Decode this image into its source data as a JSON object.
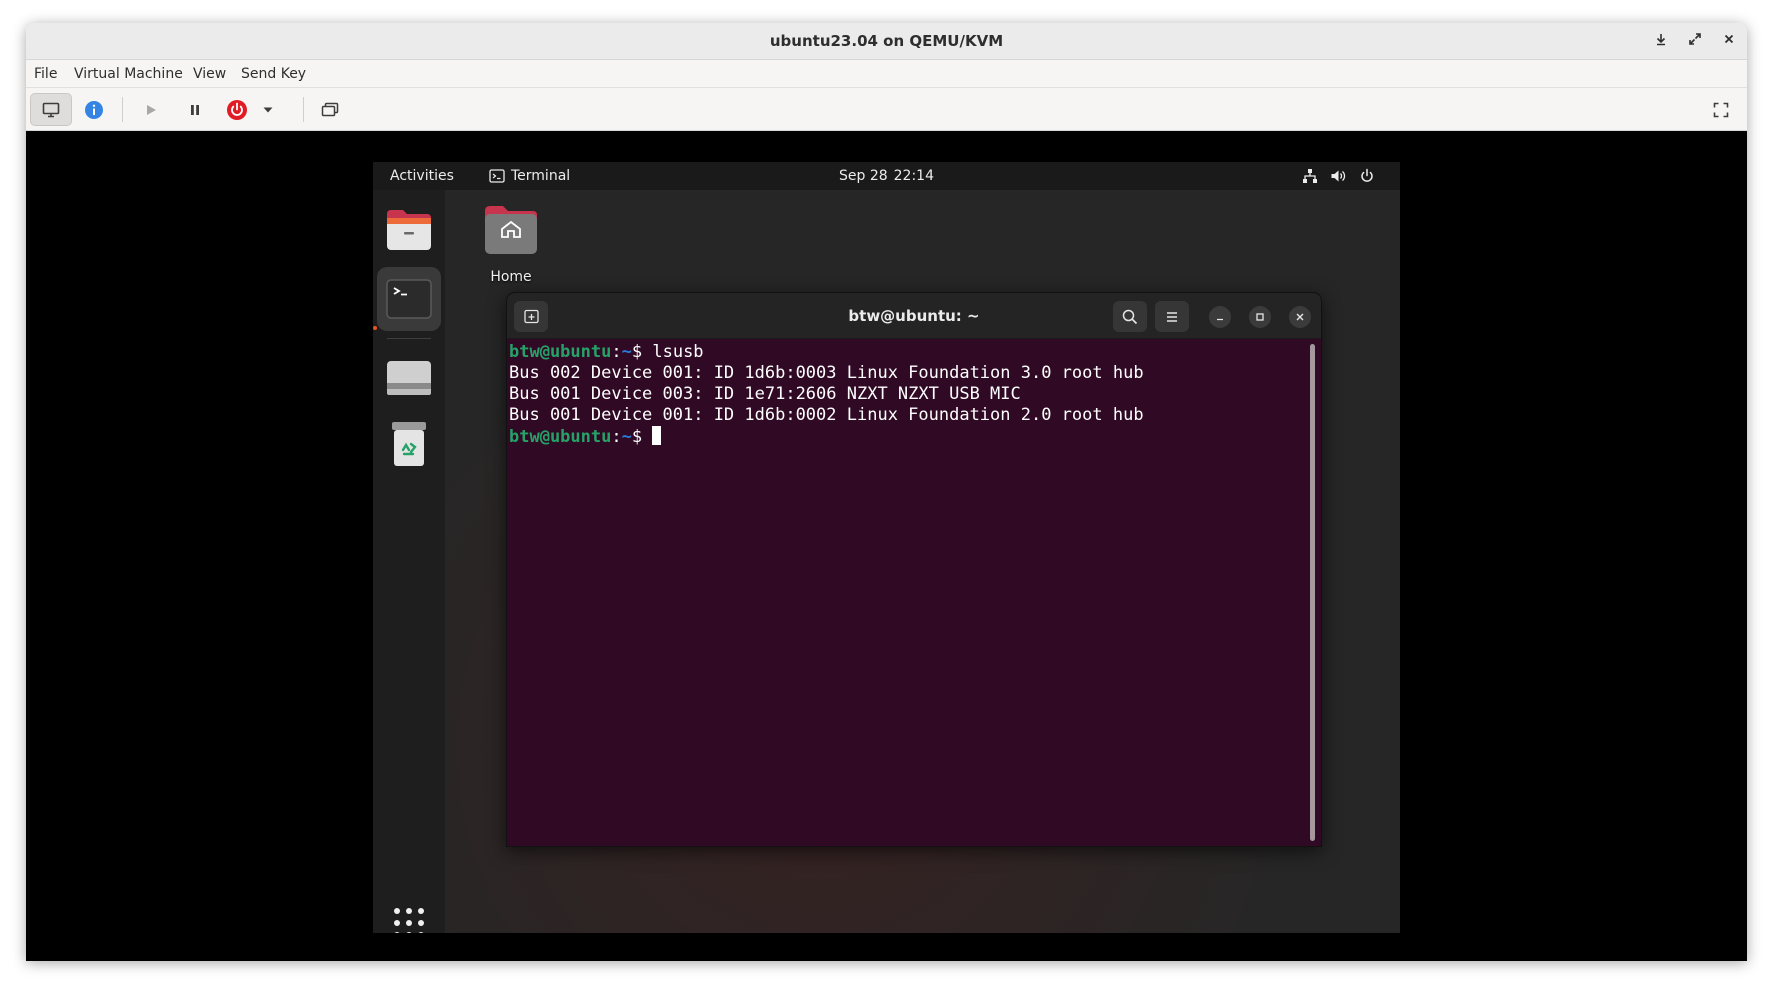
{
  "window": {
    "title": "ubuntu23.04 on QEMU/KVM",
    "controls": [
      "minimize-icon",
      "maximize-icon",
      "close-icon"
    ]
  },
  "menu": {
    "file": "File",
    "virtual_machine": "Virtual Machine",
    "view": "View",
    "send_key": "Send Key"
  },
  "toolbar": {
    "buttons": [
      "monitor-icon",
      "info-icon",
      "play-icon",
      "pause-icon",
      "power-icon",
      "dropdown-icon",
      "snapshot-icon",
      "fullscreen-icon"
    ],
    "colors": {
      "info": "#3584e4",
      "power": "#e01b24"
    }
  },
  "gnome": {
    "activities": "Activities",
    "app_name": "Terminal",
    "date": "Sep 28",
    "time": "22:14",
    "tray": [
      "network-icon",
      "volume-icon",
      "power-icon"
    ]
  },
  "dock": {
    "items": [
      "files-icon",
      "terminal-icon",
      "drive-icon",
      "trash-icon",
      "show-apps-icon"
    ],
    "running_indicator_color": "#e95420"
  },
  "desktop": {
    "home_label": "Home"
  },
  "terminal": {
    "title": "btw@ubuntu: ~",
    "prompt_user": "btw@ubuntu",
    "prompt_sep": ":",
    "prompt_path": "~",
    "prompt_dollar": "$",
    "command": "lsusb",
    "output": [
      "Bus 002 Device 001: ID 1d6b:0003 Linux Foundation 3.0 root hub",
      "Bus 001 Device 003: ID 1e71:2606 NZXT NZXT USB MIC",
      "Bus 001 Device 001: ID 1d6b:0002 Linux Foundation 2.0 root hub"
    ],
    "colors": {
      "background": "#300a24",
      "user": "#26a269",
      "path": "#2a7bde"
    }
  }
}
